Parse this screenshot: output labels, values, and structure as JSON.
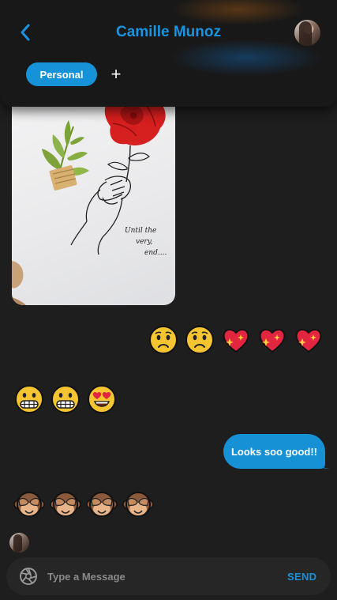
{
  "header": {
    "contact_name": "Camille Munoz",
    "tag": "Personal",
    "add_tag": "+"
  },
  "messages": {
    "photo": {
      "caption": "Until the very end...."
    },
    "emoji_row_1": [
      "worried-face",
      "worried-face",
      "sparkling-heart",
      "sparkling-heart",
      "sparkling-heart"
    ],
    "emoji_row_2": [
      "grimacing-face",
      "grimacing-face",
      "heart-eyes-face"
    ],
    "sent_text": "Looks soo good!!",
    "emoji_row_3": [
      "see-no-evil-monkey",
      "see-no-evil-monkey",
      "see-no-evil-monkey",
      "see-no-evil-monkey"
    ]
  },
  "composer": {
    "placeholder": "Type a Message",
    "value": "",
    "send_label": "SEND"
  },
  "colors": {
    "accent": "#1692d8",
    "background": "#1e1e1e",
    "header": "#181818",
    "composer": "#262626"
  }
}
